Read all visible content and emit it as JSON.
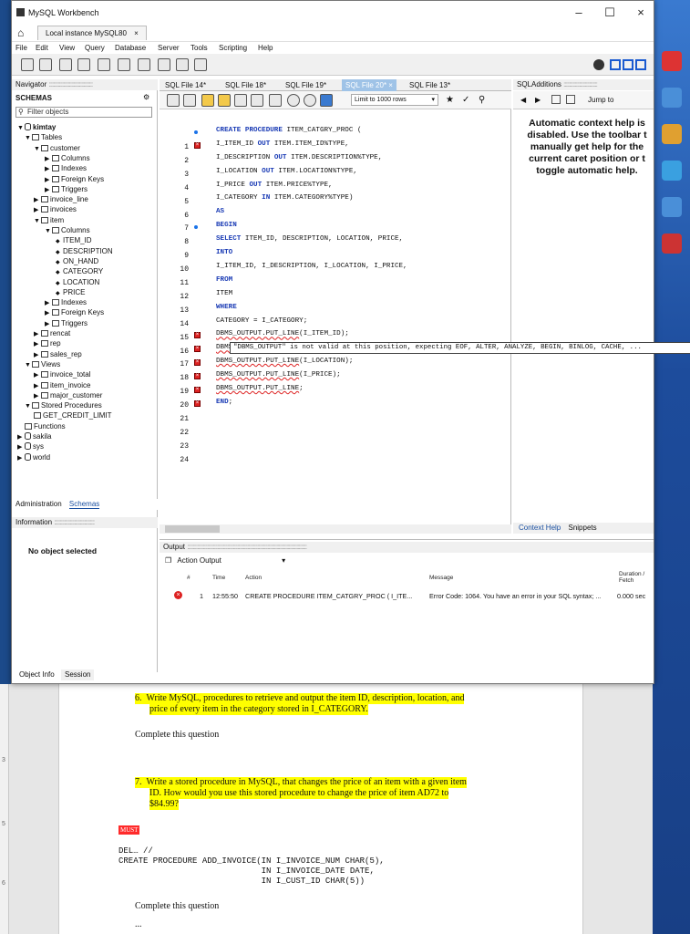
{
  "window": {
    "title": "MySQL Workbench",
    "connection_tab": "Local instance MySQL80",
    "close_glyph": "×"
  },
  "menu": [
    "File",
    "Edit",
    "View",
    "Query",
    "Database",
    "Server",
    "Tools",
    "Scripting",
    "Help"
  ],
  "navigator": {
    "header": "Navigator",
    "schemas_label": "SCHEMAS",
    "filter_placeholder": "Filter objects",
    "tree": [
      {
        "label": "kimtay",
        "level": 0,
        "arrow": "▼",
        "icon": "db",
        "bold": true
      },
      {
        "label": "Tables",
        "level": 1,
        "arrow": "▼",
        "icon": "folder"
      },
      {
        "label": "customer",
        "level": 2,
        "arrow": "▼",
        "icon": "table"
      },
      {
        "label": "Columns",
        "level": 3,
        "arrow": "▶",
        "icon": "folder"
      },
      {
        "label": "Indexes",
        "level": 3,
        "arrow": "▶",
        "icon": "folder"
      },
      {
        "label": "Foreign Keys",
        "level": 3,
        "arrow": "▶",
        "icon": "folder"
      },
      {
        "label": "Triggers",
        "level": 3,
        "arrow": "▶",
        "icon": "folder"
      },
      {
        "label": "invoice_line",
        "level": 2,
        "arrow": "▶",
        "icon": "table"
      },
      {
        "label": "invoices",
        "level": 2,
        "arrow": "▶",
        "icon": "table"
      },
      {
        "label": "item",
        "level": 2,
        "arrow": "▼",
        "icon": "table"
      },
      {
        "label": "Columns",
        "level": 3,
        "arrow": "▼",
        "icon": "folder"
      },
      {
        "label": "ITEM_ID",
        "level": 4,
        "arrow": "◆",
        "icon": "none"
      },
      {
        "label": "DESCRIPTION",
        "level": 4,
        "arrow": "◆",
        "icon": "none"
      },
      {
        "label": "ON_HAND",
        "level": 4,
        "arrow": "◆",
        "icon": "none"
      },
      {
        "label": "CATEGORY",
        "level": 4,
        "arrow": "◆",
        "icon": "none"
      },
      {
        "label": "LOCATION",
        "level": 4,
        "arrow": "◆",
        "icon": "none"
      },
      {
        "label": "PRICE",
        "level": 4,
        "arrow": "◆",
        "icon": "none"
      },
      {
        "label": "Indexes",
        "level": 3,
        "arrow": "▶",
        "icon": "folder"
      },
      {
        "label": "Foreign Keys",
        "level": 3,
        "arrow": "▶",
        "icon": "folder"
      },
      {
        "label": "Triggers",
        "level": 3,
        "arrow": "▶",
        "icon": "folder"
      },
      {
        "label": "rencat",
        "level": 2,
        "arrow": "▶",
        "icon": "table"
      },
      {
        "label": "rep",
        "level": 2,
        "arrow": "▶",
        "icon": "table"
      },
      {
        "label": "sales_rep",
        "level": 2,
        "arrow": "▶",
        "icon": "table"
      },
      {
        "label": "Views",
        "level": 1,
        "arrow": "▼",
        "icon": "folder"
      },
      {
        "label": "invoice_total",
        "level": 2,
        "arrow": "▶",
        "icon": "table"
      },
      {
        "label": "item_invoice",
        "level": 2,
        "arrow": "▶",
        "icon": "table"
      },
      {
        "label": "major_customer",
        "level": 2,
        "arrow": "▶",
        "icon": "table"
      },
      {
        "label": "Stored Procedures",
        "level": 1,
        "arrow": "▼",
        "icon": "folder"
      },
      {
        "label": "GET_CREDIT_LIMIT",
        "level": 2,
        "arrow": "",
        "icon": "table"
      },
      {
        "label": "Functions",
        "level": 1,
        "arrow": "",
        "icon": "folder"
      },
      {
        "label": "sakila",
        "level": 0,
        "arrow": "▶",
        "icon": "db"
      },
      {
        "label": "sys",
        "level": 0,
        "arrow": "▶",
        "icon": "db"
      },
      {
        "label": "world",
        "level": 0,
        "arrow": "▶",
        "icon": "db"
      }
    ],
    "tabs": [
      "Administration",
      "Schemas"
    ],
    "info_header": "Information",
    "no_object": "No object selected",
    "bottom_tabs": [
      "Object Info",
      "Session"
    ]
  },
  "editor": {
    "tabs": [
      "SQL File 14*",
      "SQL File 18*",
      "SQL File 19*",
      "SQL File 20*",
      "SQL File 13*"
    ],
    "active_tab": 3,
    "limit_label": "Limit to 1000 rows",
    "lines": [
      {
        "n": "1",
        "text": "",
        "mark": ""
      },
      {
        "n": "2",
        "text": "CREATE PROCEDURE ITEM_CATGRY_PROC (",
        "mark": "dot"
      },
      {
        "n": "3",
        "text": "I_ITEM_ID OUT ITEM.ITEM_ID%TYPE,",
        "mark": "err"
      },
      {
        "n": "4",
        "text": "I_DESCRIPTION OUT ITEM.DESCRIPTION%TYPE,",
        "mark": ""
      },
      {
        "n": "5",
        "text": "I_LOCATION OUT ITEM.LOCATION%TYPE,",
        "mark": ""
      },
      {
        "n": "6",
        "text": "I_PRICE OUT ITEM.PRICE%TYPE,",
        "mark": ""
      },
      {
        "n": "7",
        "text": "I_CATEGORY IN ITEM.CATEGORY%TYPE)",
        "mark": ""
      },
      {
        "n": "8",
        "text": "AS",
        "mark": ""
      },
      {
        "n": "9",
        "text": "BEGIN",
        "mark": "dot"
      },
      {
        "n": "10",
        "text": "SELECT ITEM_ID, DESCRIPTION, LOCATION, PRICE,",
        "mark": ""
      },
      {
        "n": "11",
        "text": "INTO",
        "mark": ""
      },
      {
        "n": "12",
        "text": "I_ITEM_ID, I_DESCRIPTION, I_LOCATION, I_PRICE,",
        "mark": ""
      },
      {
        "n": "13",
        "text": "FROM",
        "mark": ""
      },
      {
        "n": "14",
        "text": "ITEM",
        "mark": ""
      },
      {
        "n": "15",
        "text": "WHERE",
        "mark": ""
      },
      {
        "n": "16",
        "text": "CATEGORY = I_CATEGORY;",
        "mark": ""
      },
      {
        "n": "17",
        "text": "DBMS_OUTPUT.PUT_LINE(I_ITEM_ID);",
        "mark": "err"
      },
      {
        "n": "18",
        "text": "DBMS_",
        "mark": "err"
      },
      {
        "n": "19",
        "text": "DBMS_OUTPUT.PUT_LINE(I_LOCATION);",
        "mark": "err"
      },
      {
        "n": "20",
        "text": "DBMS_OUTPUT.PUT_LINE(I_PRICE);",
        "mark": "err"
      },
      {
        "n": "21",
        "text": "DBMS_OUTPUT.PUT_LINE;",
        "mark": "err"
      },
      {
        "n": "22",
        "text": "END;",
        "mark": "err"
      },
      {
        "n": "23",
        "text": "",
        "mark": ""
      },
      {
        "n": "24",
        "text": "",
        "mark": ""
      }
    ],
    "tooltip": "\"DBMS_OUTPUT\" is not valid at this position, expecting EOF, ALTER, ANALYZE, BEGIN, BINLOG, CACHE, ..."
  },
  "sql_additions": {
    "header": "SQLAdditions",
    "jump_to": "Jump to",
    "help_text": "Automatic context help is disabled. Use the toolbar t manually get help for the current caret position or t toggle automatic help.",
    "tabs": [
      "Context Help",
      "Snippets"
    ]
  },
  "output": {
    "header": "Output",
    "selector": "Action Output",
    "columns": [
      "#",
      "Time",
      "Action",
      "Message",
      "Duration / Fetch"
    ],
    "rows": [
      {
        "num": "1",
        "time": "12:55:50",
        "action": "CREATE PROCEDURE ITEM_CATGRY_PROC ( I_ITE...",
        "message": "Error Code: 1064. You have an error in your SQL syntax; ...",
        "duration": "0.000 sec"
      }
    ]
  },
  "document": {
    "q6_number": "6.",
    "q6_text_line1": "Write MySQL, procedures to retrieve and output the item ID, description, location, and",
    "q6_text_line2": "price of every item in the category stored in I_CATEGORY.",
    "complete1": "Complete this question",
    "q7_number": "7.",
    "q7_text_line1": "Write a stored procedure in MySQL, that changes the price of an item with a given item",
    "q7_text_line2": "ID. How would you use this stored procedure to change the price of item AD72 to",
    "q7_text_line3": "$84.99?",
    "red_label": "MUST",
    "code1": "DEL… //",
    "code2": "CREATE PROCEDURE ADD_INVOICE(IN I_INVOICE_NUM CHAR(5),",
    "code3": "                             IN I_INVOICE_DATE DATE,",
    "code4": "                             IN I_CUST_ID CHAR(5))",
    "complete2": "Complete this question",
    "ellipsis": "..."
  },
  "colors": {
    "keyword": "#1a3bb5",
    "error": "#d22222",
    "highlight": "#ffff00",
    "active_tab": "#9fc3e7"
  }
}
